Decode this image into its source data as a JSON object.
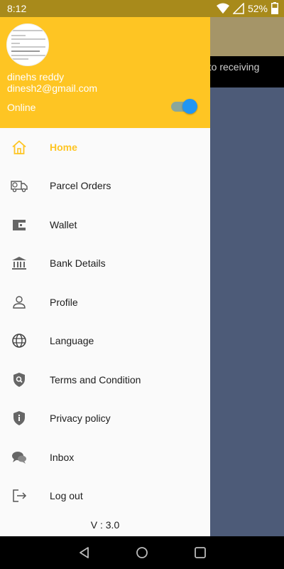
{
  "status_bar": {
    "time": "8:12",
    "battery": "52%"
  },
  "background": {
    "banner_text": "t to receiving"
  },
  "drawer": {
    "user_name": "dinehs reddy",
    "user_email": "dinesh2@gmail.com",
    "status_label": "Online",
    "online_toggle_on": true,
    "accent_color": "#fec523",
    "toggle_color": "#2196f3",
    "menu": [
      {
        "label": "Home",
        "icon": "home-icon",
        "active": true
      },
      {
        "label": "Parcel Orders",
        "icon": "delivery-truck-icon"
      },
      {
        "label": "Wallet",
        "icon": "wallet-icon"
      },
      {
        "label": "Bank Details",
        "icon": "bank-icon"
      },
      {
        "label": "Profile",
        "icon": "person-icon"
      },
      {
        "label": "Language",
        "icon": "globe-icon"
      },
      {
        "label": "Terms and Condition",
        "icon": "shield-search-icon"
      },
      {
        "label": "Privacy policy",
        "icon": "shield-info-icon"
      },
      {
        "label": "Inbox",
        "icon": "chat-bubbles-icon"
      },
      {
        "label": "Log out",
        "icon": "logout-icon"
      }
    ],
    "version": "V : 3.0"
  }
}
